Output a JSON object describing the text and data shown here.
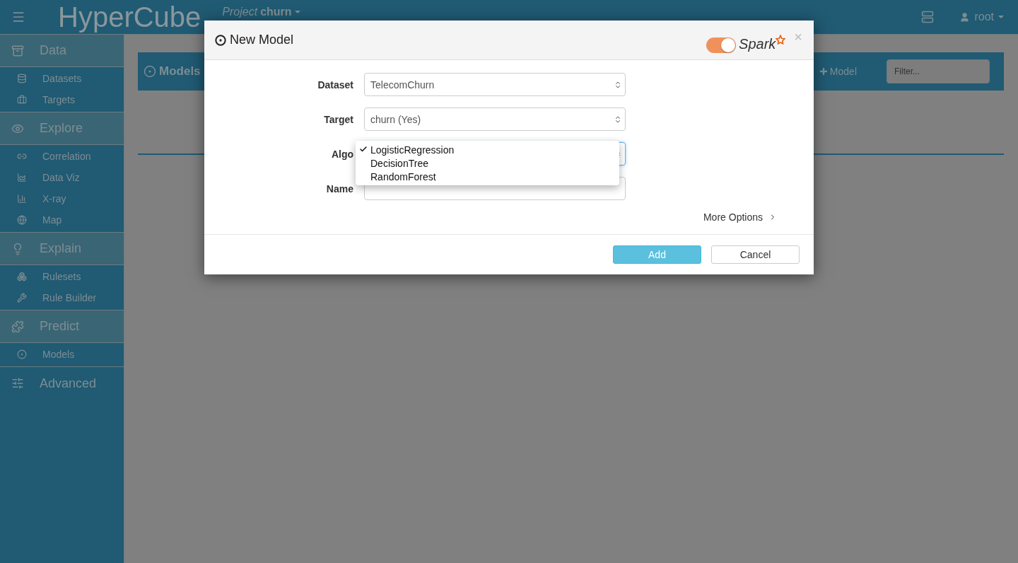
{
  "topbar": {
    "brand": "HyperCube",
    "project_prefix": "Project",
    "project_name": "churn",
    "user": "root"
  },
  "sidebar": [
    {
      "label": "Data",
      "expanded": true,
      "items": [
        {
          "label": "Datasets"
        },
        {
          "label": "Targets"
        }
      ]
    },
    {
      "label": "Explore",
      "expanded": true,
      "items": [
        {
          "label": "Correlation"
        },
        {
          "label": "Data Viz"
        },
        {
          "label": "X-ray"
        },
        {
          "label": "Map"
        }
      ]
    },
    {
      "label": "Explain",
      "expanded": true,
      "items": [
        {
          "label": "Rulesets"
        },
        {
          "label": "Rule Builder"
        }
      ]
    },
    {
      "label": "Predict",
      "expanded": true,
      "items": [
        {
          "label": "Models"
        }
      ]
    },
    {
      "label": "Advanced",
      "expanded": false
    }
  ],
  "panel": {
    "title": "Models",
    "add_label": "Model",
    "filter_placeholder": "Filter..."
  },
  "modal": {
    "title": "New Model",
    "spark_on": true,
    "spark_label": "Spark",
    "close": "×",
    "fields": [
      {
        "label": "Dataset",
        "kind": "select",
        "value": "TelecomChurn"
      },
      {
        "label": "Target",
        "kind": "select",
        "value": "churn (Yes)"
      },
      {
        "label": "Algo",
        "kind": "select",
        "expanded": true,
        "options": [
          {
            "label": "LogisticRegression",
            "selected": true
          },
          {
            "label": "DecisionTree",
            "selected": false
          },
          {
            "label": "RandomForest",
            "selected": false
          }
        ]
      },
      {
        "label": "Name",
        "kind": "text"
      }
    ],
    "more_options": "More Options",
    "buttons": [
      {
        "label": "Add",
        "kind": "primary"
      },
      {
        "label": "Cancel",
        "kind": "default"
      }
    ]
  }
}
